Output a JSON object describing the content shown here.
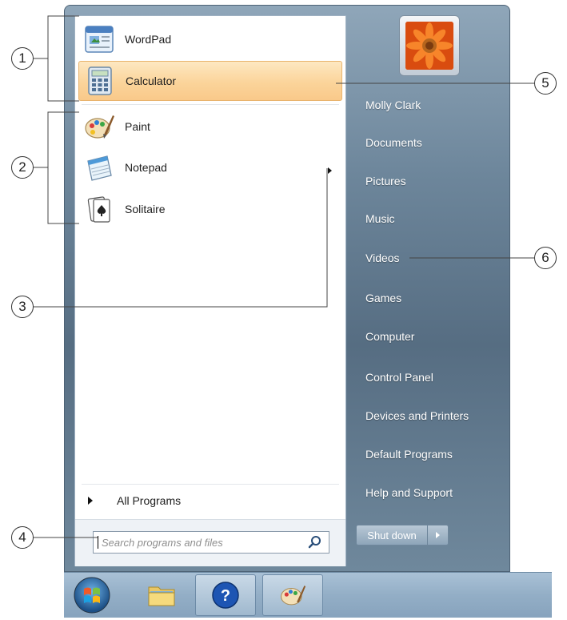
{
  "programs": [
    {
      "label": "WordPad",
      "icon": "wordpad-icon"
    },
    {
      "label": "Calculator",
      "icon": "calculator-icon",
      "highlighted": true
    },
    {
      "label": "Paint",
      "icon": "paint-icon"
    },
    {
      "label": "Notepad",
      "icon": "notepad-icon"
    },
    {
      "label": "Solitaire",
      "icon": "solitaire-icon"
    }
  ],
  "all_programs": "All Programs",
  "search": {
    "placeholder": "Search programs and files"
  },
  "right_links": [
    "Molly Clark",
    "Documents",
    "Pictures",
    "Music",
    "Videos",
    "Games",
    "Computer",
    "Control Panel",
    "Devices and Printers",
    "Default Programs",
    "Help and Support"
  ],
  "shutdown_label": "Shut down",
  "callouts": [
    "1",
    "2",
    "3",
    "4",
    "5",
    "6"
  ],
  "colors": {
    "highlight": "#fbd49a",
    "right_pane": "#566d82",
    "taskbar": "#93aec6"
  }
}
